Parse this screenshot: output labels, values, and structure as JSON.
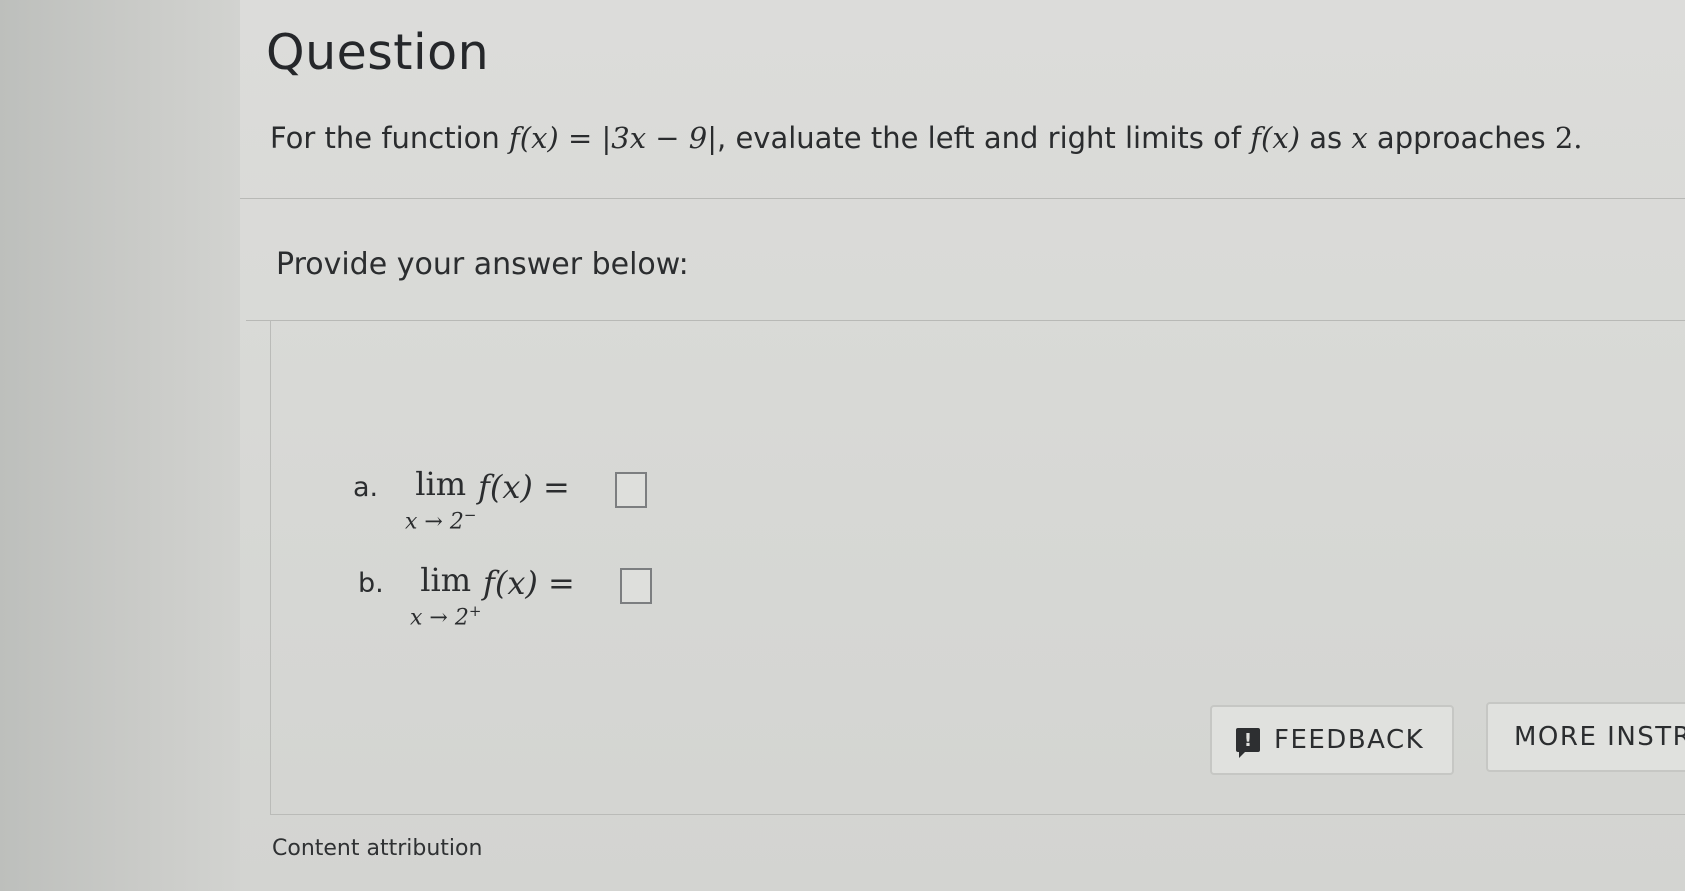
{
  "page": {
    "title": "Question"
  },
  "question": {
    "text_before": "For the function ",
    "function_expr": "f(x) = |3x − 9|",
    "text_middle": ", evaluate the left and right limits of ",
    "limit_target": "f(x)",
    "text_as": " as ",
    "variable": "x",
    "text_approaches": " approaches ",
    "approach_value": "2."
  },
  "answer": {
    "heading": "Provide your answer below:",
    "parts": [
      {
        "letter": "a.",
        "lim": "lim",
        "subscript": "x → 2",
        "side": "−",
        "expression": "f(x) =",
        "value": ""
      },
      {
        "letter": "b.",
        "lim": "lim",
        "subscript": "x → 2",
        "side": "+",
        "expression": "f(x) =",
        "value": ""
      }
    ]
  },
  "actions": {
    "feedback_icon": "!",
    "feedback_label": "FEEDBACK",
    "more_label": "MORE INSTR"
  },
  "footer": {
    "attribution": "Content attribution"
  }
}
